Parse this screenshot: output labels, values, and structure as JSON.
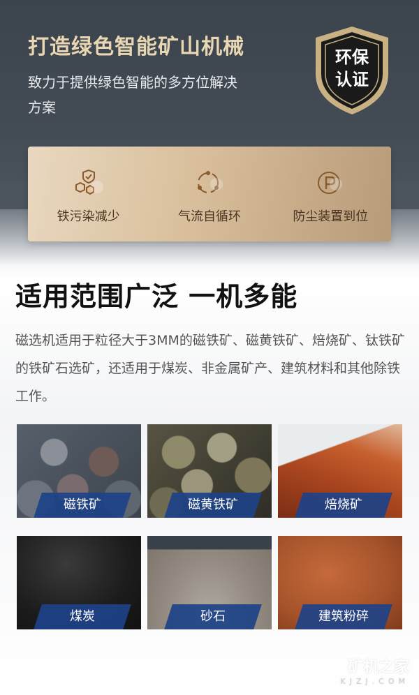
{
  "hero": {
    "title": "打造绿色智能矿山机械",
    "subtitle": "致力于提供绿色智能的多方位解决方案",
    "badge_line1": "环保",
    "badge_line2": "认证"
  },
  "features": [
    {
      "label": "铁污染减少",
      "icon": "shield-cluster-icon"
    },
    {
      "label": "气流自循环",
      "icon": "cycle-arrows-icon"
    },
    {
      "label": "防尘装置到位",
      "icon": "p-circle-icon"
    }
  ],
  "section": {
    "title": "适用范围广泛 一机多能",
    "description": "磁选机适用于粒径大于3MM的磁铁矿、磁黄铁矿、焙烧矿、钛铁矿的铁矿石选矿，还适用于煤炭、非金属矿产、建筑材料和其他除铁工作。"
  },
  "materials": [
    {
      "label": "磁铁矿"
    },
    {
      "label": "磁黄铁矿"
    },
    {
      "label": "焙烧矿"
    },
    {
      "label": "煤炭"
    },
    {
      "label": "砂石"
    },
    {
      "label": "建筑粉碎"
    }
  ],
  "watermark": {
    "main": "矿机之家",
    "sub": "KJZJ.COM"
  },
  "colors": {
    "gold": "#e9d6b3",
    "tag_blue": "#1d4288",
    "card": "#d9bf9c"
  }
}
